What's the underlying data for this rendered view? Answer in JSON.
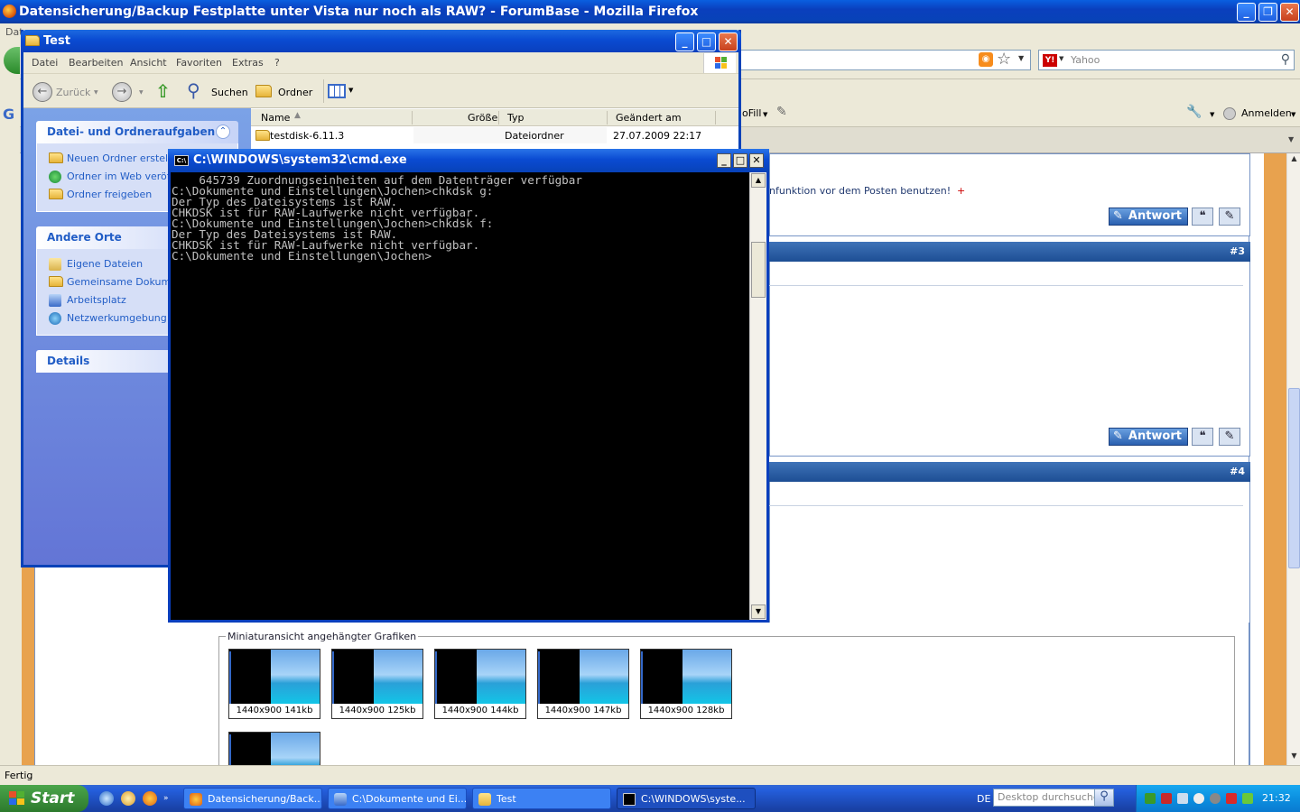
{
  "firefox": {
    "title": "Datensicherung/Backup Festplatte unter Vista nur noch als RAW? - ForumBase - Mozilla Firefox",
    "menu_partial": "Dat",
    "search_placeholder": "Yahoo",
    "toolbar_fill": "oFill",
    "toolbar_anmelden": "Anmelden",
    "status": "Fertig"
  },
  "forum": {
    "post_hint": "nfunktion vor dem Posten benutzen!",
    "post_hint_plus": "+",
    "answer_label": "Antwort",
    "post3": "#3",
    "post4": "#4",
    "attach_legend": "Miniaturansicht angehängter Grafiken",
    "thumbs": [
      {
        "caption": "1440x900 141kb"
      },
      {
        "caption": "1440x900 125kb"
      },
      {
        "caption": "1440x900 144kb"
      },
      {
        "caption": "1440x900 147kb"
      },
      {
        "caption": "1440x900 128kb"
      }
    ]
  },
  "explorer": {
    "title": "Test",
    "menu": [
      "Datei",
      "Bearbeiten",
      "Ansicht",
      "Favoriten",
      "Extras",
      "?"
    ],
    "back_label": "Zurück",
    "search_label": "Suchen",
    "folders_label": "Ordner",
    "tasks_title": "Datei- und Ordneraufgaben",
    "tasks": [
      "Neuen Ordner erstellen",
      "Ordner im Web veröffentlichen",
      "Ordner freigeben"
    ],
    "places_title": "Andere Orte",
    "places": [
      "Eigene Dateien",
      "Gemeinsame Dokumente",
      "Arbeitsplatz",
      "Netzwerkumgebung"
    ],
    "details_title": "Details",
    "columns": {
      "name": "Name",
      "size": "Größe",
      "type": "Typ",
      "modified": "Geändert am"
    },
    "files": [
      {
        "name": "testdisk-6.11.3",
        "type": "Dateiordner",
        "modified": "27.07.2009 22:17"
      }
    ]
  },
  "cmd": {
    "title": "C:\\WINDOWS\\system32\\cmd.exe",
    "lines": [
      "    645739 Zuordnungseinheiten auf dem Datenträger verfügbar",
      "",
      "C:\\Dokumente und Einstellungen\\Jochen>chkdsk g:",
      "Der Typ des Dateisystems ist RAW.",
      "CHKDSK ist für RAW-Laufwerke nicht verfügbar.",
      "",
      "",
      "C:\\Dokumente und Einstellungen\\Jochen>chkdsk f:",
      "Der Typ des Dateisystems ist RAW.",
      "CHKDSK ist für RAW-Laufwerke nicht verfügbar.",
      "",
      "",
      "C:\\Dokumente und Einstellungen\\Jochen>"
    ]
  },
  "taskbar": {
    "start": "Start",
    "tasks": [
      {
        "label": "Datensicherung/Back..."
      },
      {
        "label": "C:\\Dokumente und Ei..."
      },
      {
        "label": "Test"
      },
      {
        "label": "C:\\WINDOWS\\syste..."
      }
    ],
    "lang": "DE",
    "desktop_search": "Desktop durchsuchen",
    "clock": "21:32"
  },
  "colors": {
    "xp_blue": "#0a4bd2",
    "task_pane": "#7ba2e7",
    "start_green": "#3c8f3c",
    "forum_orange": "#e8a24e"
  }
}
